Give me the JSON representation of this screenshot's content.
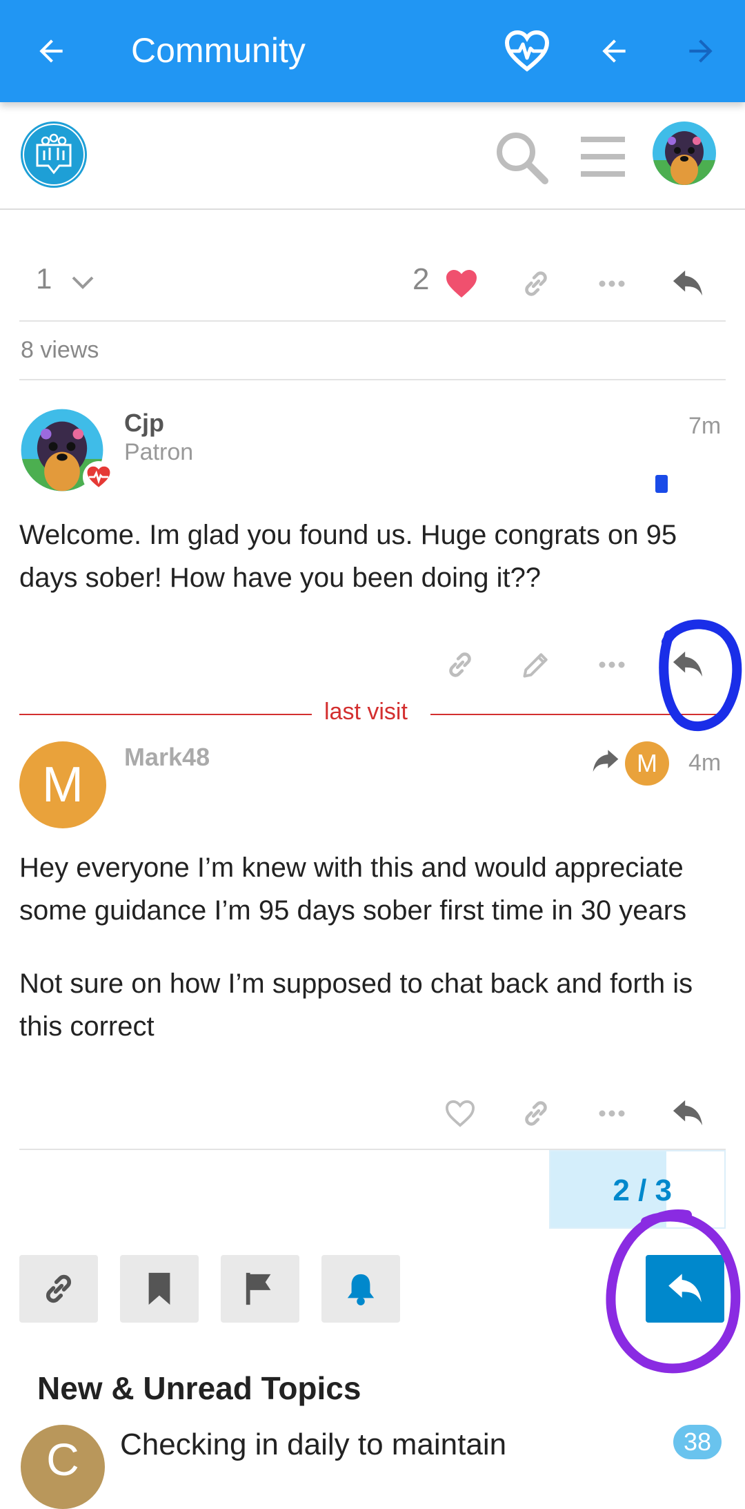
{
  "appbar": {
    "title": "Community"
  },
  "post1": {
    "likes_expand_count": "1",
    "like_count": "2",
    "views": "8 views"
  },
  "post2": {
    "username": "Cjp",
    "title": "Patron",
    "time": "7m",
    "body": "Welcome. Im glad you found us. Huge congrats on 95 days sober! How have you been doing it??"
  },
  "divider": {
    "label": "last visit"
  },
  "post3": {
    "username": "Mark48",
    "avatar_letter": "M",
    "reply_avatar_letter": "M",
    "time": "4m",
    "paragraph1": "Hey everyone I’m knew with this and would appreciate some guidance I’m 95 days sober first time in 30 years",
    "paragraph2": "Not sure on how I’m supposed to chat back and forth is this correct"
  },
  "progress": {
    "label": "2 / 3",
    "current": 2,
    "total": 3
  },
  "section": {
    "title": "New & Unread Topics"
  },
  "topic": {
    "avatar_letter": "C",
    "title": "Checking in daily to maintain",
    "count": "38"
  },
  "colors": {
    "appbar": "#2196F3",
    "accent": "#0088CC",
    "heart": "#F0506E",
    "last_visit": "#D32F2F",
    "avatar_m": "#E9A23B",
    "annotation_blue": "#1A2EE8",
    "annotation_purple": "#8A2BE2"
  }
}
